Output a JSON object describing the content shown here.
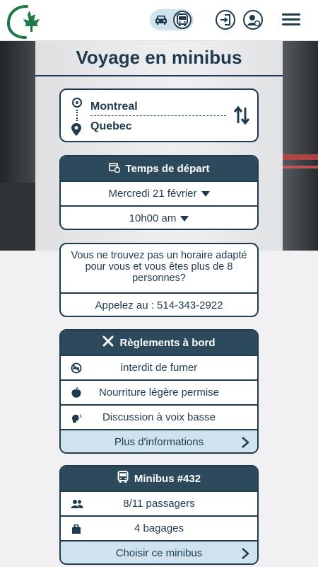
{
  "header": {
    "logo": {
      "icon": "maple-leaf-logo",
      "accent": "#1e7a45"
    },
    "mode_toggle": {
      "options": [
        "car-icon",
        "bus-icon"
      ],
      "selected": "bus"
    },
    "login_icon": "login-icon",
    "account_icon": "account-icon",
    "menu_icon": "hamburger-icon"
  },
  "main": {
    "title": "Voyage en minibus",
    "route": {
      "from": "Montreal",
      "to": "Quebec"
    },
    "departure": {
      "header": "Temps de départ",
      "date": "Mercredi 21 février",
      "time": "10h00 am"
    },
    "help": {
      "message": "Vous ne trouvez pas un horaire adapté pour vous et vous êtes plus de 8 personnes?",
      "phone_line": "Appelez au : 514-343-2922"
    },
    "rules": {
      "header": "Règlements à bord",
      "items": [
        {
          "icon": "no-smoking-icon",
          "label": "interdit de fumer"
        },
        {
          "icon": "apple-icon",
          "label": "Nourriture légère permise"
        },
        {
          "icon": "speaking-head-icon",
          "label": "Discussion à voix basse"
        }
      ],
      "more_label": "Plus d'informations"
    },
    "minibus": {
      "header": "Minibus #432",
      "passengers": "8/11 passagers",
      "bags": "4 bagages",
      "choose_label": "Choisir ce minibus"
    }
  },
  "colors": {
    "primary": "#1f3b4d",
    "header_bg": "#2c4a5c",
    "action_bg": "#cfe3ee",
    "page_bg": "#f1f1f3"
  }
}
